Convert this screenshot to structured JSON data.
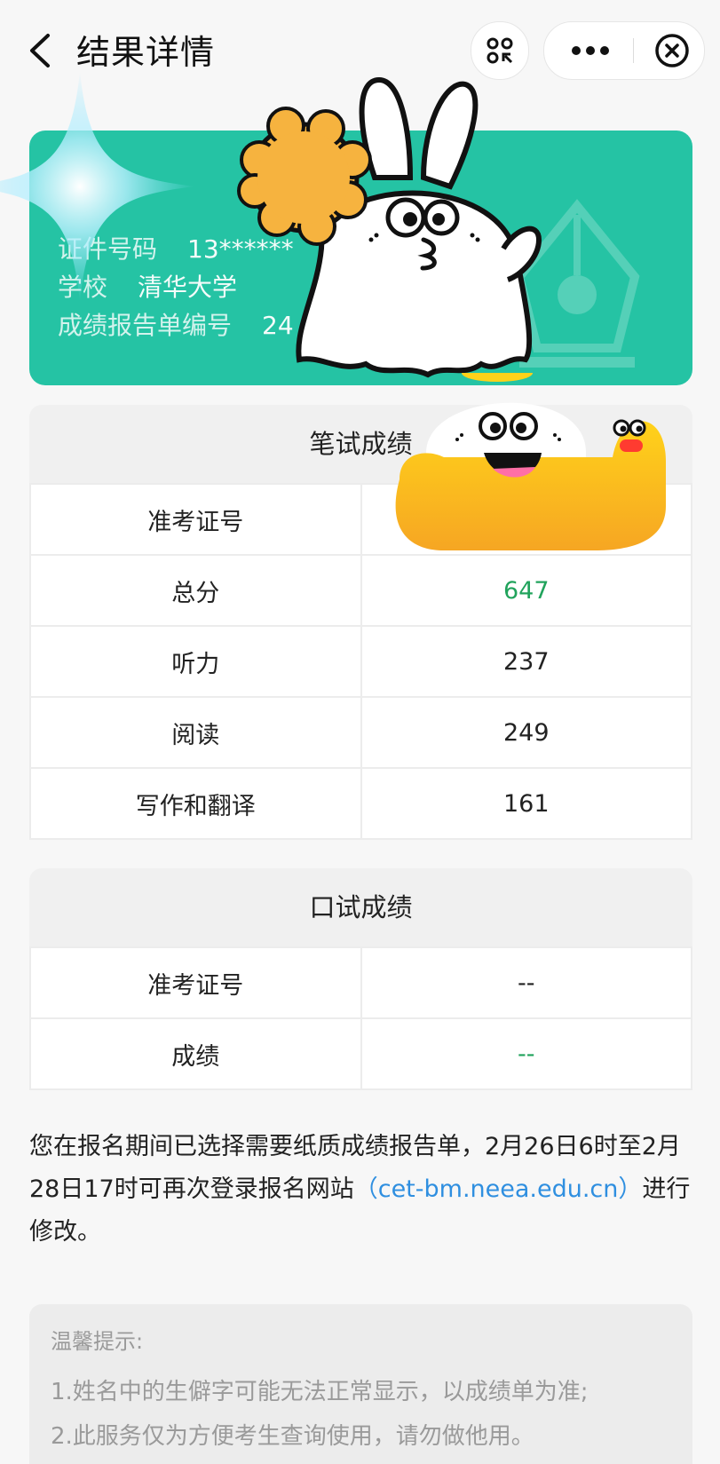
{
  "header": {
    "title": "结果详情",
    "back_icon": "chevron-left-icon",
    "scan_icon": "scan-icon",
    "more_icon": "more-icon",
    "close_icon": "close-circle-icon"
  },
  "card": {
    "row1_label": "证件号码",
    "row1_value": "13******",
    "row2_label": "学校",
    "row2_value": "清华大学",
    "row3_label": "成绩报告单编号",
    "row3_value": "24",
    "bg_color": "#25c3a4"
  },
  "written": {
    "title": "笔试成绩",
    "rows": [
      {
        "label": "准考证号",
        "value": ""
      },
      {
        "label": "总分",
        "value": "647"
      },
      {
        "label": "听力",
        "value": "237"
      },
      {
        "label": "阅读",
        "value": "249"
      },
      {
        "label": "写作和翻译",
        "value": "161"
      }
    ]
  },
  "oral": {
    "title": "口试成绩",
    "rows": [
      {
        "label": "准考证号",
        "value": "--"
      },
      {
        "label": "成绩",
        "value": "--"
      }
    ]
  },
  "notice": {
    "text_before": "您在报名期间已选择需要纸质成绩报告单，2月26日6时至2月28日17时可再次登录报名网站",
    "link": "（cet-bm.neea.edu.cn）",
    "text_after": "进行修改。"
  },
  "tips": {
    "title": "温馨提示:",
    "line1": "1.姓名中的生僻字可能无法正常显示，以成绩单为准;",
    "line2": "2.此服务仅为方便考生查询使用，请勿做他用。"
  },
  "colors": {
    "accent_green": "#21a35c",
    "link_blue": "#2f8fe0"
  }
}
